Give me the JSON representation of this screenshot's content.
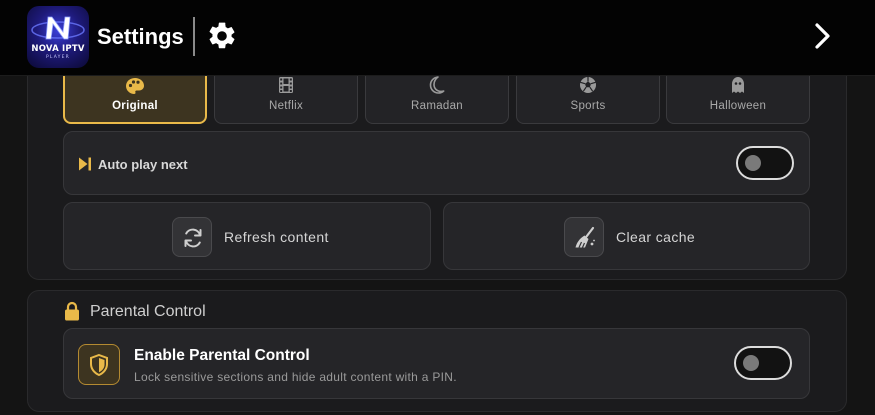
{
  "header": {
    "app_logo_text": "NOVA IPTV",
    "app_logo_sub": "PLAYER",
    "title": "Settings",
    "icons": {
      "settings": "gear-icon",
      "next": "chevron-right-icon"
    }
  },
  "themes": {
    "items": [
      {
        "label": "Original",
        "icon": "palette-icon",
        "selected": true
      },
      {
        "label": "Netflix",
        "icon": "film-icon",
        "selected": false
      },
      {
        "label": "Ramadan",
        "icon": "crescent-moon-icon",
        "selected": false
      },
      {
        "label": "Sports",
        "icon": "soccer-ball-icon",
        "selected": false
      },
      {
        "label": "Halloween",
        "icon": "ghost-icon",
        "selected": false
      }
    ]
  },
  "playback": {
    "autoplay_label": "Auto play next",
    "autoplay_enabled": false
  },
  "actions": {
    "refresh_label": "Refresh content",
    "clear_cache_label": "Clear cache"
  },
  "parental": {
    "section_title": "Parental Control",
    "enable_title": "Enable Parental Control",
    "enable_description": "Lock sensitive sections and hide adult content with a PIN.",
    "enabled": false
  },
  "colors": {
    "accent": "#e9b949",
    "background": "#141414",
    "header": "#030303",
    "card": "#252528"
  }
}
